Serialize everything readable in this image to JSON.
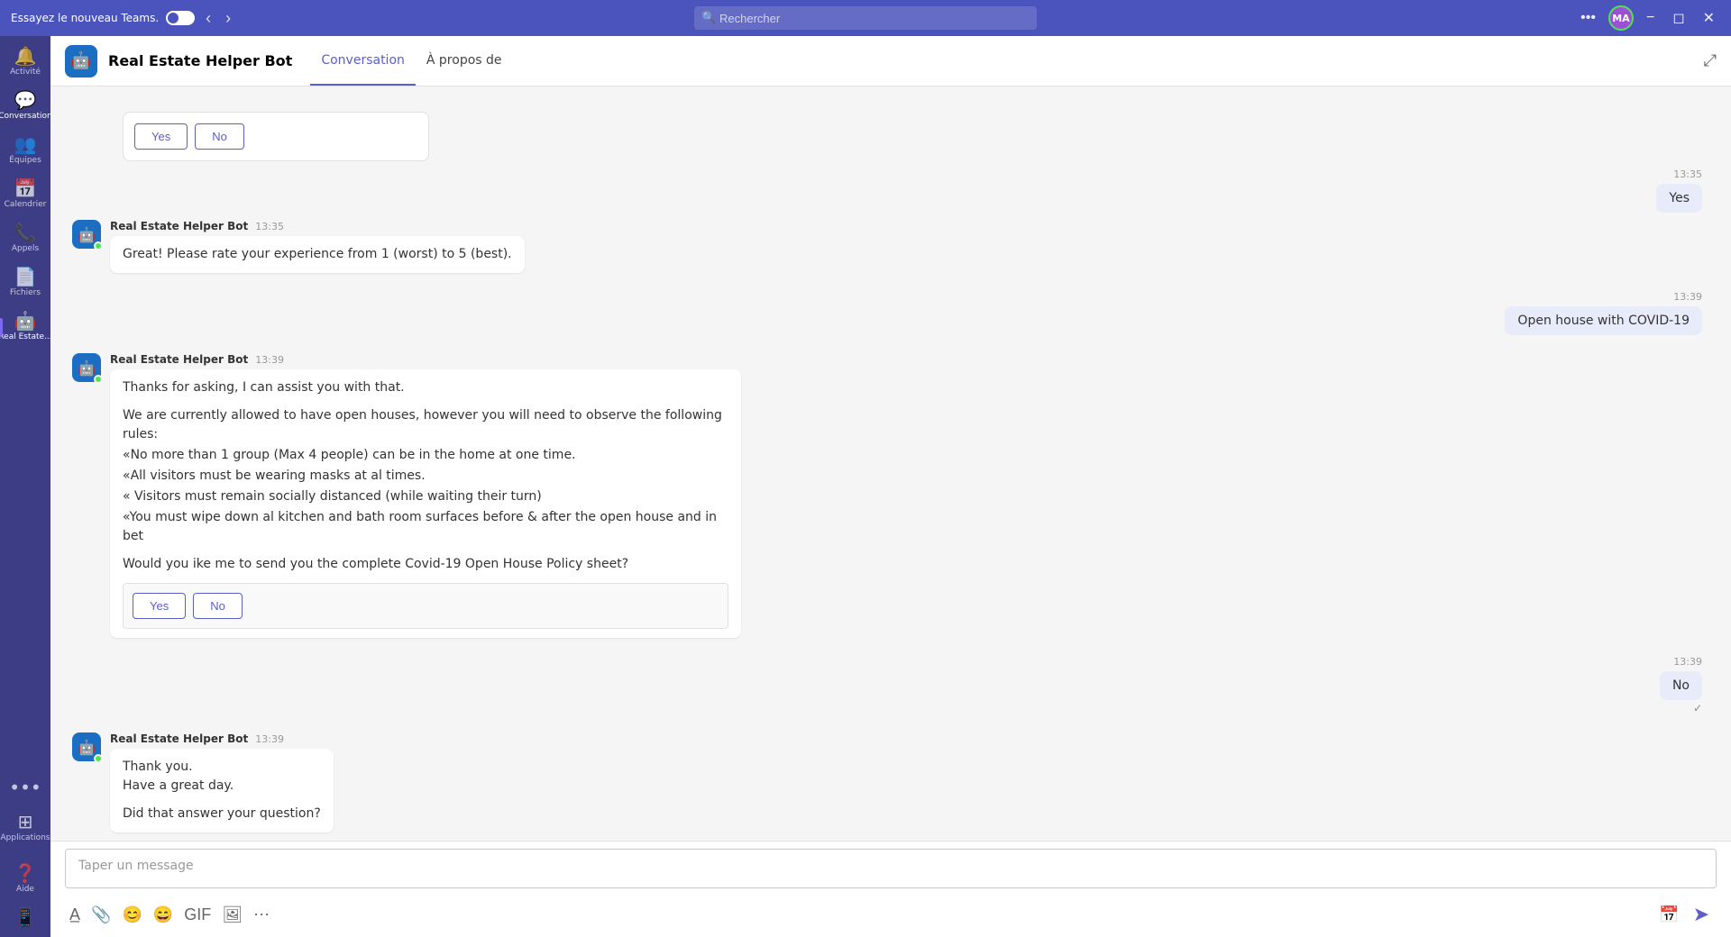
{
  "titlebar": {
    "try_teams_label": "Essayez le nouveau Teams.",
    "search_placeholder": "Rechercher",
    "avatar_initials": "MA",
    "nav_back": "‹",
    "nav_forward": "›",
    "more_label": "•••"
  },
  "sidebar": {
    "items": [
      {
        "id": "activity",
        "label": "Activité",
        "icon": "🔔"
      },
      {
        "id": "conversation",
        "label": "Conversation",
        "icon": "💬",
        "active": true
      },
      {
        "id": "teams",
        "label": "Équipes",
        "icon": "👥"
      },
      {
        "id": "calendar",
        "label": "Calendrier",
        "icon": "📅"
      },
      {
        "id": "calls",
        "label": "Appels",
        "icon": "📞"
      },
      {
        "id": "files",
        "label": "Fichiers",
        "icon": "📄"
      },
      {
        "id": "realestate",
        "label": "Real Estate...",
        "icon": "🤖",
        "active2": true
      },
      {
        "id": "applications",
        "label": "Applications",
        "icon": "⊞"
      }
    ],
    "more_label": "•••",
    "help_label": "Aide",
    "phone_label": ""
  },
  "chat_header": {
    "bot_name": "Real Estate Helper Bot",
    "tabs": [
      {
        "id": "conversation",
        "label": "Conversation",
        "active": true
      },
      {
        "id": "about",
        "label": "À propos de"
      }
    ]
  },
  "messages": [
    {
      "id": "yn1",
      "type": "bot_yn",
      "buttons": [
        "Yes",
        "No"
      ]
    },
    {
      "id": "user1",
      "type": "user",
      "time": "13:35",
      "text": "Yes"
    },
    {
      "id": "bot1",
      "type": "bot",
      "sender": "Real Estate Helper Bot",
      "time": "13:35",
      "text": "Great! Please rate your experience from 1 (worst) to 5 (best)."
    },
    {
      "id": "user2",
      "type": "user",
      "time": "13:39",
      "text": "Open house with COVID-19"
    },
    {
      "id": "bot2",
      "type": "bot_long",
      "sender": "Real Estate Helper Bot",
      "time": "13:39",
      "intro": "Thanks for asking, I can assist you with that.",
      "body_lines": [
        "We are currently allowed to have open houses, however you will need to observe the following rules:",
        "«No more than 1 group (Max 4 people) can be in the home at one time.",
        "«All visitors must be wearing masks at al times.",
        "« Visitors must remain socially distanced (while waiting their turn)",
        "«You must wipe down al kitchen and bath room surfaces before & after the open house and in bet"
      ],
      "question": "Would you ike me to send you the complete Covid-19 Open House Policy sheet?",
      "buttons": [
        "Yes",
        "No"
      ]
    },
    {
      "id": "user3",
      "type": "user",
      "time": "13:39",
      "text": "No",
      "has_check": true
    },
    {
      "id": "bot3",
      "type": "bot_multi",
      "sender": "Real Estate Helper Bot",
      "time": "13:39",
      "lines": [
        "Thank you.",
        "Have a great day.",
        "",
        "Did that answer your question?"
      ]
    }
  ],
  "compose": {
    "placeholder": "Taper un message"
  }
}
